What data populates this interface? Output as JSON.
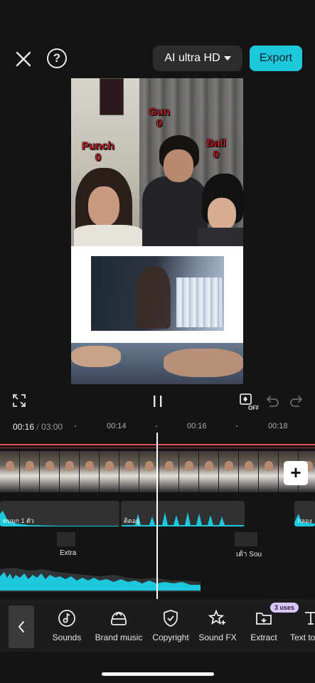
{
  "header": {
    "quality_label": "AI ultra HD",
    "export_label": "Export"
  },
  "preview": {
    "counters": [
      {
        "label": "Punch",
        "value": "0"
      },
      {
        "label": "Gun",
        "value": "0"
      },
      {
        "label": "Ball",
        "value": "0"
      }
    ]
  },
  "timeline": {
    "current_time": "00:16",
    "separator": " / ",
    "total_time": "03:00",
    "ticks": [
      "00:14",
      "00:16",
      "00:18"
    ],
    "audio_clips": [
      {
        "label": "ตบมุก 1 ตัว"
      },
      {
        "label": "ติดอยู่"
      },
      {
        "label": "กลอง"
      }
    ],
    "extra_labels": [
      "Extra",
      "เต้า Sou"
    ]
  },
  "toolbar": {
    "tools": [
      {
        "label": "Sounds",
        "icon": "music-note-icon"
      },
      {
        "label": "Brand music",
        "icon": "brand-music-icon"
      },
      {
        "label": "Copyright",
        "icon": "shield-check-icon"
      },
      {
        "label": "Sound FX",
        "icon": "star-sparkle-icon"
      },
      {
        "label": "Extract",
        "icon": "folder-extract-icon"
      },
      {
        "label": "Text to",
        "icon": "text-icon"
      }
    ],
    "uses_badge": "3 uses"
  },
  "colors": {
    "accent": "#1ec8dc",
    "background": "#141414",
    "counter_red": "#e8202a"
  }
}
